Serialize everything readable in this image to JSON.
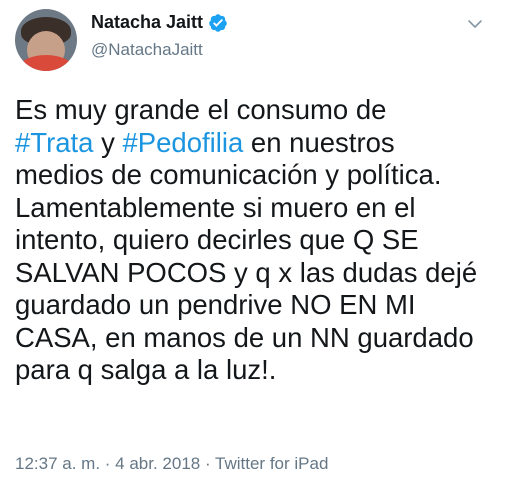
{
  "user": {
    "display_name": "Natacha Jaitt",
    "handle": "@NatachaJaitt",
    "verified_icon": "verified-badge-icon",
    "menu_icon": "chevron-down-icon"
  },
  "tweet": {
    "l1": "Es muy grande el consumo de",
    "l2_tag1": "#Trata",
    "l2_y": " y ",
    "l2_tag2": "#Pedofilia",
    "l2_rest": " en nuestros",
    "l3": "medios de comunicación y política.",
    "l4": "Lamentablemente si muero en el",
    "l5": "intento, quiero decirles que Q SE",
    "l6": "SALVAN POCOS y q x las dudas dejé",
    "l7": "guardado un pendrive NO EN MI",
    "l8": "CASA, en manos de un NN guardado",
    "l9": "para q salga a la luz!."
  },
  "meta": {
    "timestamp": "12:37 a. m. · 4 abr. 2018 · Twitter for iPad"
  },
  "colors": {
    "hashtag": "#1b95e0",
    "verified": "#1da1f2",
    "secondary_text": "#657786"
  }
}
